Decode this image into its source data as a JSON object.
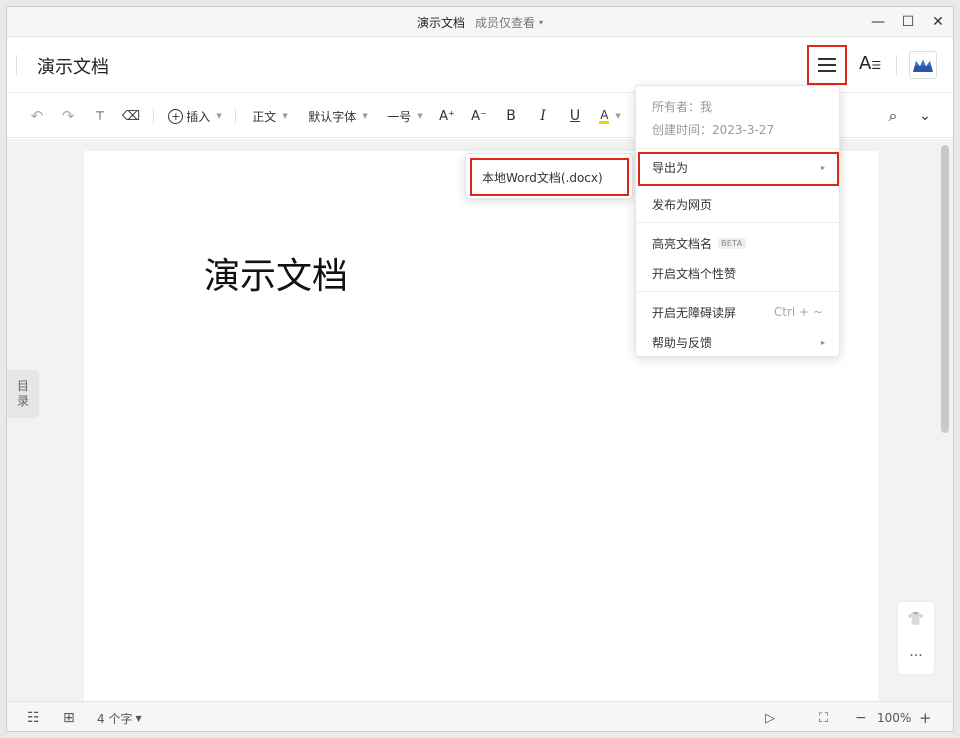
{
  "titlebar": {
    "doc_name": "演示文档",
    "permission": "成员仅查看",
    "caret": "▾",
    "minimize": "—",
    "maximize": "☐",
    "close": "✕"
  },
  "header": {
    "title": "演示文档",
    "font_button": "A"
  },
  "toolbar": {
    "undo": "↶",
    "redo": "↷",
    "format_painter": "🖌",
    "eraser": "⌫",
    "insert": "插入",
    "style": "正文",
    "font": "默认字体",
    "size": "一号",
    "grow": "A⁺",
    "shrink": "A⁻",
    "bold": "B",
    "italic": "I",
    "underline": "U",
    "highlight": "A",
    "search": "⌕",
    "more": "⌄"
  },
  "document": {
    "heading": "演示文档"
  },
  "outline": {
    "label1": "目",
    "label2": "录"
  },
  "float_tools": {
    "theme": "👕",
    "more": "···"
  },
  "statusbar": {
    "word_count": "4 个字",
    "zoom": "100%",
    "zoom_out": "−",
    "zoom_in": "+",
    "play": "▷",
    "fullscreen": "⛶"
  },
  "main_menu": {
    "owner": "所有者：我",
    "created": "创建时间：2023-3-27",
    "items": [
      {
        "label": "导出为",
        "has_submenu": true
      },
      {
        "label": "发布为网页"
      },
      {
        "label": "高亮文档名",
        "badge": "BETA"
      },
      {
        "label": "开启文档个性赞"
      },
      {
        "label": "开启无障碍读屏",
        "shortcut": "Ctrl + ~"
      },
      {
        "label": "帮助与反馈",
        "has_submenu": true
      }
    ],
    "arrow": "▸"
  },
  "export_submenu": {
    "items": [
      {
        "label": "本地Word文档(.docx)"
      }
    ]
  },
  "colors": {
    "highlight_box": "#e0251b",
    "highlight_underline": "#f2d100"
  }
}
